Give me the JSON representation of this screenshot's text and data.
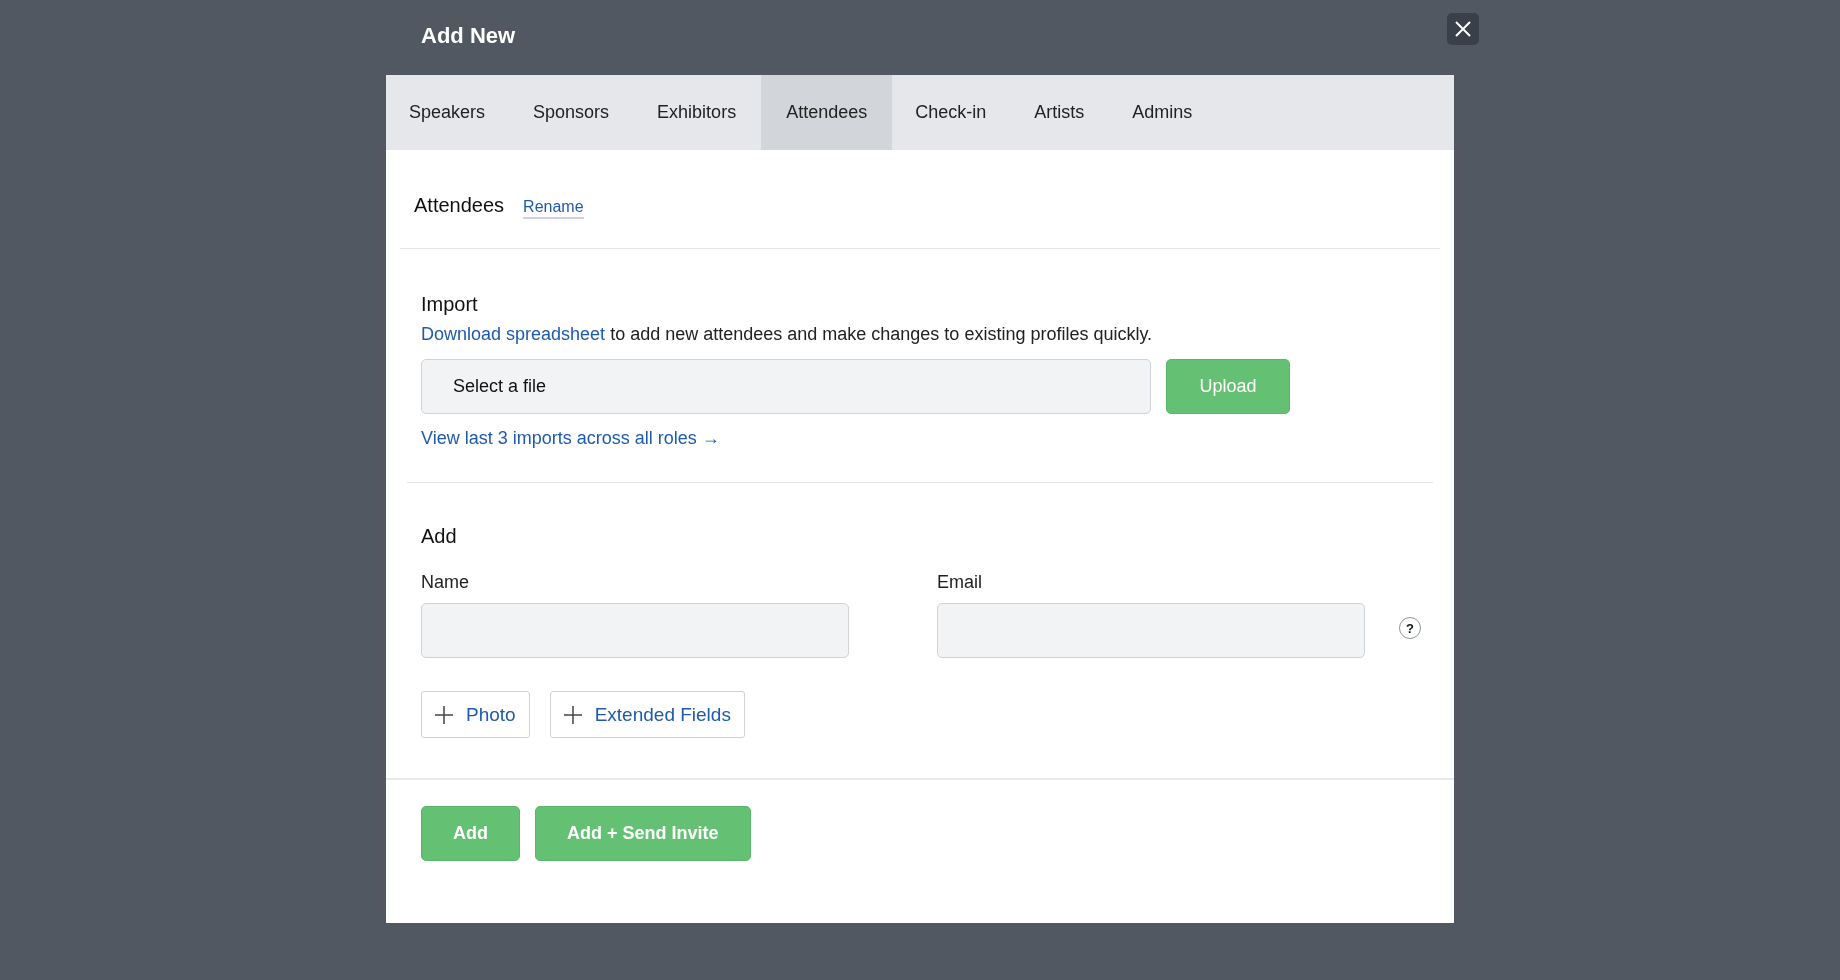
{
  "dialog": {
    "title": "Add New"
  },
  "tabs": [
    {
      "label": "Speakers",
      "selected": false
    },
    {
      "label": "Sponsors",
      "selected": false
    },
    {
      "label": "Exhibitors",
      "selected": false
    },
    {
      "label": "Attendees",
      "selected": true
    },
    {
      "label": "Check-in",
      "selected": false
    },
    {
      "label": "Artists",
      "selected": false
    },
    {
      "label": "Admins",
      "selected": false
    }
  ],
  "section": {
    "title": "Attendees",
    "rename_link": "Rename"
  },
  "import": {
    "heading": "Import",
    "link": "Download spreadsheet",
    "description": "to add new attendees and make changes to existing profiles quickly.",
    "file_field": {
      "placeholder": "Select a file"
    },
    "upload_button": "Upload",
    "history_link": "View last 3 imports across all roles →"
  },
  "add": {
    "heading": "Add",
    "fields": [
      {
        "label": "Name"
      },
      {
        "label": "Email"
      }
    ],
    "help": "?",
    "extra_buttons": [
      "Photo",
      "Extended Fields"
    ]
  },
  "footer_buttons": [
    "Add",
    "Add + Send Invite"
  ]
}
